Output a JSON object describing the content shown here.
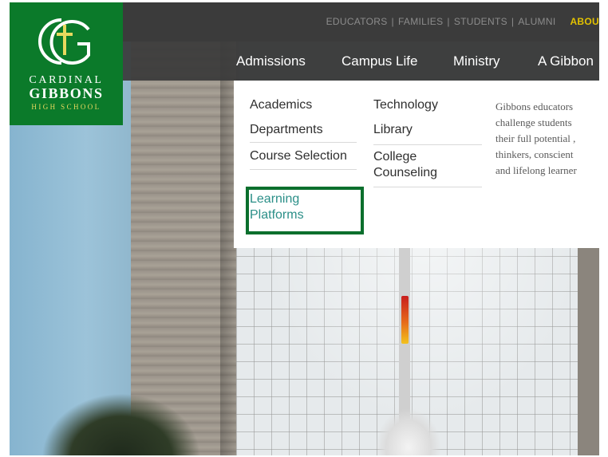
{
  "utility_nav": {
    "items": [
      "EDUCATORS",
      "FAMILIES",
      "STUDENTS",
      "ALUMNI"
    ],
    "separator": "|",
    "about": "ABOU"
  },
  "main_nav": {
    "items": [
      "Admissions",
      "Campus Life",
      "Ministry",
      "A Gibbon"
    ]
  },
  "logo": {
    "line1": "CARDINAL",
    "line2": "GIBBONS",
    "line3": "HIGH SCHOOL",
    "icon": "cg-cross-monogram-icon"
  },
  "dropdown": {
    "col1": [
      "Academics",
      "Departments",
      "Course Selection",
      "Learning Platforms"
    ],
    "col2": [
      "Technology",
      "Library",
      "College Counseling"
    ],
    "blurb_lines": [
      "Gibbons educators",
      "challenge students",
      "their full potential ,",
      "thinkers, conscient",
      "and lifelong learner"
    ]
  },
  "colors": {
    "brand_green": "#0b7a2a",
    "highlight_green": "#0b6f2d",
    "accent_yellow": "#e3c200",
    "link_teal": "#2b8f88",
    "nav_dark": "#3b3b3b"
  }
}
